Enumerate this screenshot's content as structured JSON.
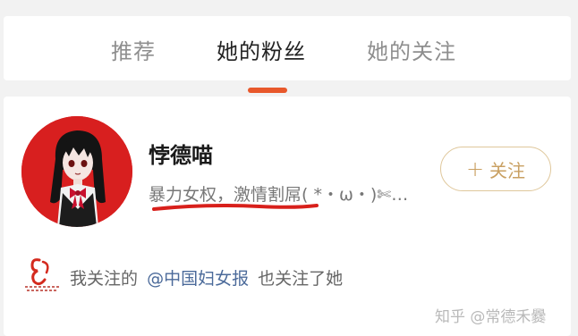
{
  "tabs": [
    {
      "label": "推荐",
      "active": false
    },
    {
      "label": "她的粉丝",
      "active": true
    },
    {
      "label": "她的关注",
      "active": false
    }
  ],
  "colors": {
    "accent": "#e8582b",
    "follow_button": "#c9a062",
    "link": "#4b6a9a",
    "avatar_background": "#d81f1f"
  },
  "user": {
    "name": "悖德喵",
    "bio": "暴力女权，激情割屌( *・ω・)✄…",
    "avatar_icon": "anime-girl-avatar"
  },
  "follow_button": {
    "icon": "plus-icon",
    "label": "关注"
  },
  "mutual": {
    "logo_icon": "china-women-news-logo",
    "prefix": "我关注的",
    "account": "@中国妇女报",
    "suffix": "也关注了她"
  },
  "watermark": "知乎 @常德禾爨"
}
